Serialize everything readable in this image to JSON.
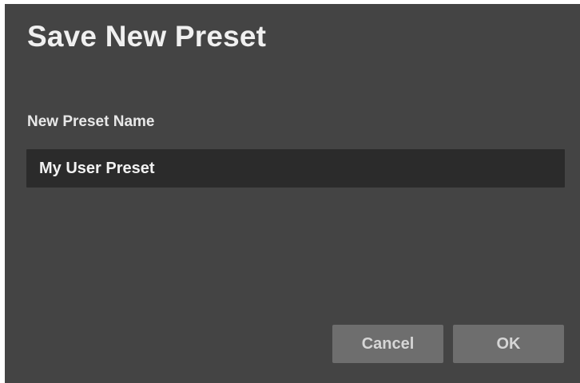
{
  "dialog": {
    "title": "Save New Preset",
    "field_label": "New Preset Name",
    "preset_name_value": "My User Preset",
    "cancel_label": "Cancel",
    "ok_label": "OK"
  },
  "colors": {
    "dialog_background": "#444444",
    "input_background": "#2b2b2b",
    "button_background": "#6e6e6e",
    "text": "#ededed"
  }
}
